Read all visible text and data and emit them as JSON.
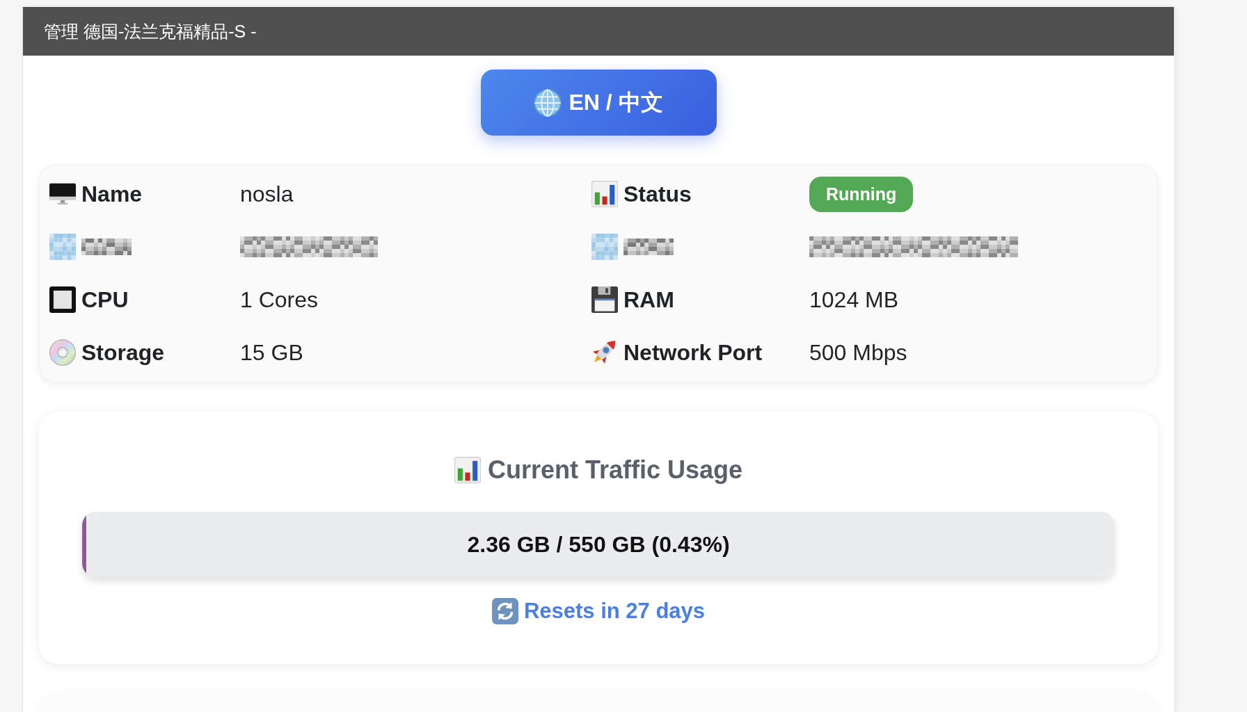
{
  "header": {
    "title": "管理 德国-法兰克福精品-S -"
  },
  "language_button": {
    "label": "EN / 中文"
  },
  "info_card": {
    "fields": [
      {
        "kind": "text",
        "label": "Name",
        "value": "nosla"
      },
      {
        "kind": "badge",
        "label": "Status",
        "value": "Running"
      },
      {
        "kind": "redacted"
      },
      {
        "kind": "redacted"
      },
      {
        "kind": "text",
        "label": "CPU",
        "value": "1 Cores"
      },
      {
        "kind": "text",
        "label": "RAM",
        "value": "1024 MB"
      },
      {
        "kind": "text",
        "label": "Storage",
        "value": "15 GB"
      },
      {
        "kind": "text",
        "label": "Network Port",
        "value": "500 Mbps"
      }
    ]
  },
  "traffic_card": {
    "title": "Current Traffic Usage",
    "usage_bar": {
      "level": 0.0043,
      "reading": "2.36 GB / 550 GB (0.43%)"
    },
    "reset_note": "Resets in 27 days"
  }
}
